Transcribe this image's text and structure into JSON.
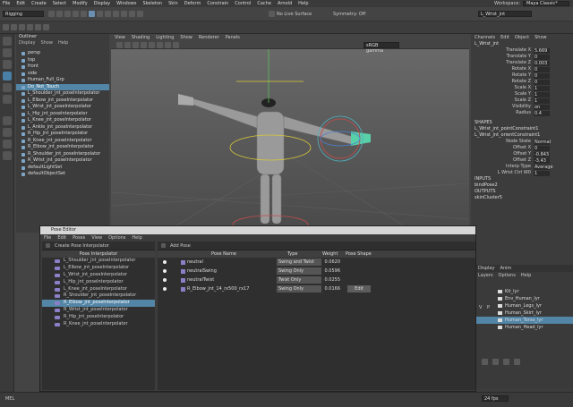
{
  "menubar": {
    "items": [
      "File",
      "Edit",
      "Create",
      "Select",
      "Modify",
      "Display",
      "Windows",
      "Skeleton",
      "Skin",
      "Deform",
      "Constrain",
      "Control",
      "Cache",
      "Arnold",
      "Help"
    ],
    "workspace_label": "Workspace:",
    "workspace_value": "Maya Classic*"
  },
  "statusline": {
    "mode": "Rigging",
    "live_surface": "No Live Surface",
    "symmetry": "Symmetry: Off",
    "object_field": "L_Wrist_jnt"
  },
  "outliner": {
    "title": "Outliner",
    "menu": [
      "Display",
      "Show",
      "Help"
    ],
    "items": [
      {
        "label": "persp",
        "selected": false
      },
      {
        "label": "top",
        "selected": false
      },
      {
        "label": "front",
        "selected": false
      },
      {
        "label": "side",
        "selected": false
      },
      {
        "label": "Human_Full_Grp",
        "selected": false
      },
      {
        "label": "Do_Not_Touch",
        "selected": true
      },
      {
        "label": "L_Shoulder_jnt_poseInterpolator",
        "selected": false
      },
      {
        "label": "L_Elbow_jnt_poseInterpolator",
        "selected": false
      },
      {
        "label": "L_Wrist_jnt_poseInterpolator",
        "selected": false
      },
      {
        "label": "L_Hip_jnt_poseInterpolator",
        "selected": false
      },
      {
        "label": "L_Knee_jnt_poseInterpolator",
        "selected": false
      },
      {
        "label": "L_Ankle_jnt_poseInterpolator",
        "selected": false
      },
      {
        "label": "R_Hip_jnt_poseInterpolator",
        "selected": false
      },
      {
        "label": "R_Knee_jnt_poseInterpolator",
        "selected": false
      },
      {
        "label": "R_Elbow_jnt_poseInterpolator",
        "selected": false
      },
      {
        "label": "R_Shoulder_jnt_poseInterpolator",
        "selected": false
      },
      {
        "label": "R_Wrist_jnt_poseInterpolator",
        "selected": false
      },
      {
        "label": "defaultLightSet",
        "selected": false
      },
      {
        "label": "defaultObjectSet",
        "selected": false
      }
    ]
  },
  "viewport": {
    "menu": [
      "View",
      "Shading",
      "Lighting",
      "Show",
      "Renderer",
      "Panels"
    ],
    "color_space": "sRGB gamma"
  },
  "channelbox": {
    "tabs": [
      "Channels",
      "Edit",
      "Object",
      "Show"
    ],
    "object_name": "L_Wrist_jnt",
    "channels": [
      {
        "name": "Translate X",
        "value": "5.669"
      },
      {
        "name": "Translate Y",
        "value": "0"
      },
      {
        "name": "Translate Z",
        "value": "0.003"
      },
      {
        "name": "Rotate X",
        "value": "0"
      },
      {
        "name": "Rotate Y",
        "value": "0"
      },
      {
        "name": "Rotate Z",
        "value": "0"
      },
      {
        "name": "Scale X",
        "value": "1"
      },
      {
        "name": "Scale Y",
        "value": "1"
      },
      {
        "name": "Scale Z",
        "value": "1"
      },
      {
        "name": "Visibility",
        "value": "on"
      },
      {
        "name": "Radius",
        "value": "0.4"
      }
    ],
    "shapes_label": "SHAPES",
    "shapes": [
      "L_Wrist_jnt_pointConstraint1",
      "L_Wrist_jnt_orientConstraint1"
    ],
    "constraint_channels": [
      {
        "name": "Node State",
        "value": "Normal"
      },
      {
        "name": "Offset X",
        "value": "0"
      },
      {
        "name": "Offset Y",
        "value": "-0.843"
      },
      {
        "name": "Offset Z",
        "value": "-3.43"
      },
      {
        "name": "Interp Type",
        "value": "Average"
      },
      {
        "name": "L Wrist Ctrl W0",
        "value": "1"
      }
    ],
    "inputs_label": "INPUTS",
    "inputs": [
      "bindPose2"
    ],
    "outputs_label": "OUTPUTS",
    "outputs": [
      "skinCluster5"
    ]
  },
  "layers": {
    "tabs": [
      "Display",
      "Anim"
    ],
    "menu": [
      "Layers",
      "Options",
      "Help"
    ],
    "items": [
      {
        "label": "Kit_lyr",
        "selected": false
      },
      {
        "label": "Env_Human_lyr",
        "selected": false
      },
      {
        "label": "Human_Legs_lyr",
        "selected": false
      },
      {
        "label": "Human_Skirt_lyr",
        "selected": false
      },
      {
        "label": "Human_Torso_lyr",
        "selected": true
      },
      {
        "label": "Human_Head_lyr",
        "selected": false
      }
    ],
    "v_label": "V",
    "p_label": "P"
  },
  "pose_editor": {
    "title": "Pose Editor",
    "menu": [
      "File",
      "Edit",
      "Poses",
      "View",
      "Options",
      "Help"
    ],
    "create_label": "Create Pose Interpolator",
    "add_pose_label": "Add Pose",
    "left_header": "Pose Interpolator",
    "interpolators": [
      {
        "label": "L_Shoulder_jnt_poseInterpolator",
        "selected": false
      },
      {
        "label": "L_Elbow_jnt_poseInterpolator",
        "selected": false
      },
      {
        "label": "L_Wrist_jnt_poseInterpolator",
        "selected": false
      },
      {
        "label": "L_Hip_jnt_poseInterpolator",
        "selected": false
      },
      {
        "label": "L_Knee_jnt_poseInterpolator",
        "selected": false
      },
      {
        "label": "R_Shoulder_jnt_poseInterpolator",
        "selected": false
      },
      {
        "label": "R_Elbow_jnt_poseInterpolator",
        "selected": true
      },
      {
        "label": "R_Wrist_jnt_poseInterpolator",
        "selected": false
      },
      {
        "label": "R_Hip_jnt_poseInterpolator",
        "selected": false
      },
      {
        "label": "R_Knee_jnt_poseInterpolator",
        "selected": false
      }
    ],
    "columns": {
      "pose_name": "Pose Name",
      "type": "Type",
      "weight": "Weight",
      "pose_shape": "Pose Shape"
    },
    "poses": [
      {
        "name": "neutral",
        "type": "Swing and Twist",
        "weight": "0.0620",
        "edit": ""
      },
      {
        "name": "neutralSwing",
        "type": "Swing Only",
        "weight": "0.0596",
        "edit": ""
      },
      {
        "name": "neutralTwist",
        "type": "Twist Only",
        "weight": "0.0255",
        "edit": ""
      },
      {
        "name": "R_Elbow_jnt_14_rx500_rx17",
        "type": "Swing Only",
        "weight": "0.0166",
        "edit": "Edit"
      }
    ]
  },
  "timeline": {
    "mel_label": "MEL",
    "fps": "24 fps"
  }
}
